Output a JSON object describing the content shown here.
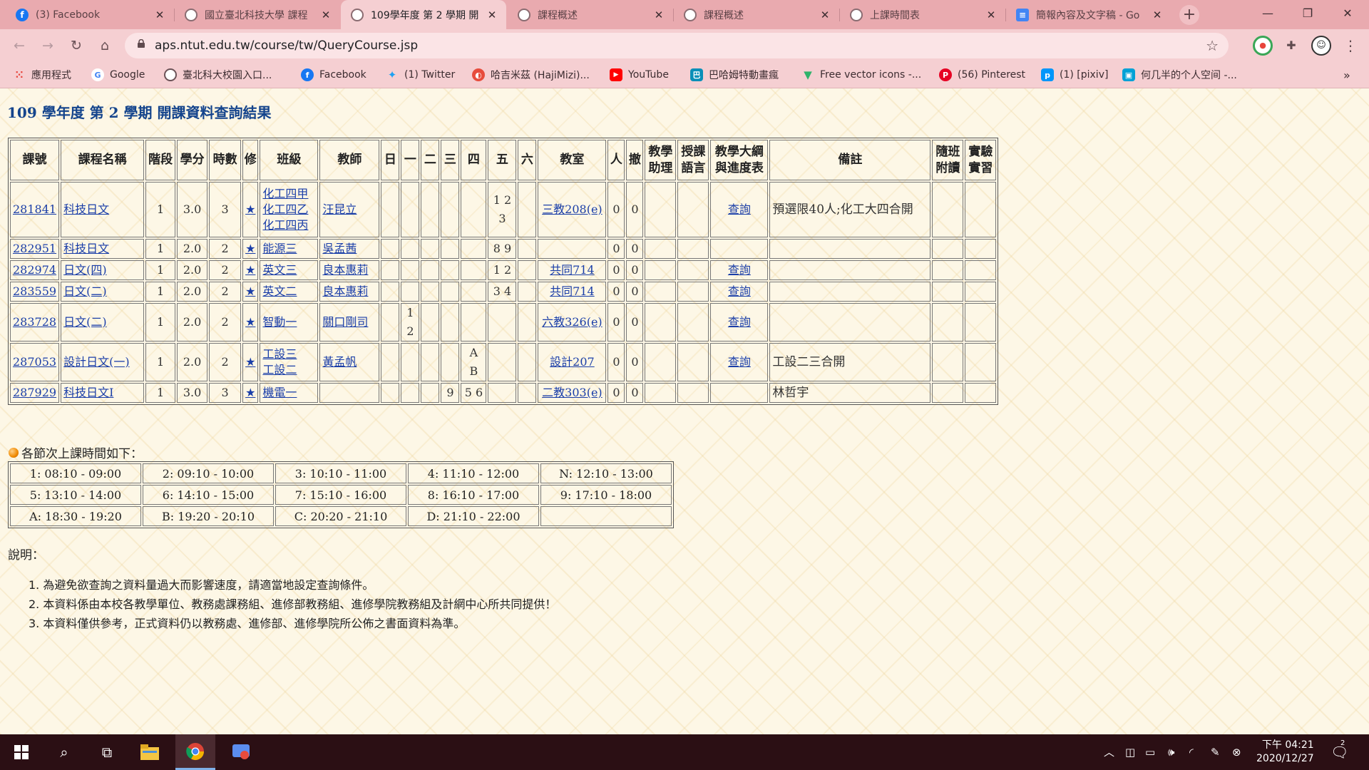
{
  "browser": {
    "tabs": [
      {
        "label": "(3) Facebook",
        "icon": "facebook-icon",
        "active": false
      },
      {
        "label": "國立臺北科技大學 課程",
        "icon": "globe-icon",
        "active": false
      },
      {
        "label": "109學年度 第 2 學期 開",
        "icon": "globe-icon",
        "active": true
      },
      {
        "label": "課程概述",
        "icon": "globe-icon",
        "active": false
      },
      {
        "label": "課程概述",
        "icon": "globe-icon",
        "active": false
      },
      {
        "label": "上課時間表",
        "icon": "globe-icon",
        "active": false
      },
      {
        "label": "簡報內容及文字稿 - Go",
        "icon": "google-docs-icon",
        "active": false
      }
    ],
    "url": "aps.ntut.edu.tw/course/tw/QueryCourse.jsp",
    "bookmarks": [
      {
        "label": "應用程式",
        "icon": "apps-grid-icon",
        "color": "#e8453c"
      },
      {
        "label": "Google",
        "icon": "google-icon",
        "color": "#4285f4"
      },
      {
        "label": "臺北科大校園入口...",
        "icon": "globe-icon",
        "color": "#6b5257"
      },
      {
        "label": "Facebook",
        "icon": "facebook-icon",
        "color": "#1877f2"
      },
      {
        "label": "(1) Twitter",
        "icon": "twitter-icon",
        "color": "#1da1f2"
      },
      {
        "label": "哈吉米茲 (HajiMizi)...",
        "icon": "hajimizi-icon",
        "color": "#e74c3c"
      },
      {
        "label": "YouTube",
        "icon": "youtube-icon",
        "color": "#ff0000"
      },
      {
        "label": "巴哈姆特動畫瘋",
        "icon": "bahamut-icon",
        "color": "#0a8fb8"
      },
      {
        "label": "Free vector icons -...",
        "icon": "freepik-icon",
        "color": "#2fb36b"
      },
      {
        "label": "(56) Pinterest",
        "icon": "pinterest-icon",
        "color": "#e60023"
      },
      {
        "label": "(1) [pixiv]",
        "icon": "pixiv-icon",
        "color": "#0096fa"
      },
      {
        "label": "何几半的个人空间 -...",
        "icon": "bilibili-icon",
        "color": "#00a1d6"
      }
    ],
    "bookmarks_overflow": "»"
  },
  "page": {
    "heading": "109 學年度 第 2 學期 開課資料查詢結果",
    "columns": [
      "課號",
      "課程名稱",
      "階段",
      "學分",
      "時數",
      "修",
      "班級",
      "教師",
      "日",
      "一",
      "二",
      "三",
      "四",
      "五",
      "六",
      "教室",
      "人",
      "撤",
      "教學助理",
      "授課語言",
      "教學大綱與進度表",
      "備註",
      "隨班附讀",
      "實驗實習"
    ],
    "rows": [
      {
        "id": "281841",
        "name": "科技日文",
        "stage": "1",
        "credit": "3.0",
        "hours": "3",
        "type": "★",
        "classes": [
          "化工四甲",
          "化工四乙",
          "化工四丙"
        ],
        "teacher": "汪昆立",
        "sun": "",
        "mon": "",
        "tue": "",
        "wed": "",
        "thu": "",
        "fri": "1 2 3",
        "sat": "",
        "room": "三教208(e)",
        "people": "0",
        "withdraw": "0",
        "ta": "",
        "lang": "",
        "syllabus": "查詢",
        "memo": "預選限40人;化工大四合開",
        "audit": "",
        "lab": ""
      },
      {
        "id": "282951",
        "name": "科技日文",
        "stage": "1",
        "credit": "2.0",
        "hours": "2",
        "type": "★",
        "classes": [
          "能源三"
        ],
        "teacher": "吳孟茜",
        "sun": "",
        "mon": "",
        "tue": "",
        "wed": "",
        "thu": "",
        "fri": "8 9",
        "sat": "",
        "room": "",
        "people": "0",
        "withdraw": "0",
        "ta": "",
        "lang": "",
        "syllabus": "",
        "memo": "",
        "audit": "",
        "lab": ""
      },
      {
        "id": "282974",
        "name": "日文(四)",
        "stage": "1",
        "credit": "2.0",
        "hours": "2",
        "type": "★",
        "classes": [
          "英文三"
        ],
        "teacher": "良本惠莉",
        "sun": "",
        "mon": "",
        "tue": "",
        "wed": "",
        "thu": "",
        "fri": "1 2",
        "sat": "",
        "room": "共同714",
        "people": "0",
        "withdraw": "0",
        "ta": "",
        "lang": "",
        "syllabus": "查詢",
        "memo": "",
        "audit": "",
        "lab": ""
      },
      {
        "id": "283559",
        "name": "日文(二)",
        "stage": "1",
        "credit": "2.0",
        "hours": "2",
        "type": "★",
        "classes": [
          "英文二"
        ],
        "teacher": "良本惠莉",
        "sun": "",
        "mon": "",
        "tue": "",
        "wed": "",
        "thu": "",
        "fri": "3 4",
        "sat": "",
        "room": "共同714",
        "people": "0",
        "withdraw": "0",
        "ta": "",
        "lang": "",
        "syllabus": "查詢",
        "memo": "",
        "audit": "",
        "lab": ""
      },
      {
        "id": "283728",
        "name": "日文(二)",
        "stage": "1",
        "credit": "2.0",
        "hours": "2",
        "type": "★",
        "classes": [
          "智動一"
        ],
        "teacher": "關口剛司",
        "sun": "",
        "mon": "1 2",
        "tue": "",
        "wed": "",
        "thu": "",
        "fri": "",
        "sat": "",
        "room": "六教326(e)",
        "people": "0",
        "withdraw": "0",
        "ta": "",
        "lang": "",
        "syllabus": "查詢",
        "memo": "",
        "audit": "",
        "lab": ""
      },
      {
        "id": "287053",
        "name": "設計日文(一)",
        "stage": "1",
        "credit": "2.0",
        "hours": "2",
        "type": "★",
        "classes": [
          "工設三",
          "工設二"
        ],
        "teacher": "黃孟帆",
        "sun": "",
        "mon": "",
        "tue": "",
        "wed": "",
        "thu": "A B",
        "fri": "",
        "sat": "",
        "room": "設計207",
        "people": "0",
        "withdraw": "0",
        "ta": "",
        "lang": "",
        "syllabus": "查詢",
        "memo": "工設二三合開",
        "audit": "",
        "lab": ""
      },
      {
        "id": "287929",
        "name": "科技日文I",
        "stage": "1",
        "credit": "3.0",
        "hours": "3",
        "type": "★",
        "classes": [
          "機電一"
        ],
        "teacher": "",
        "sun": "",
        "mon": "",
        "tue": "",
        "wed": "9",
        "thu": "5 6",
        "fri": "",
        "sat": "",
        "room": "二教303(e)",
        "people": "0",
        "withdraw": "0",
        "ta": "",
        "lang": "",
        "syllabus": "",
        "memo": "林哲宇",
        "audit": "",
        "lab": ""
      }
    ],
    "time_heading": "各節次上課時間如下：",
    "time_slots": [
      [
        "1: 08:10 - 09:00",
        "2: 09:10 - 10:00",
        "3: 10:10 - 11:00",
        "4: 11:10 - 12:00",
        "N: 12:10 - 13:00"
      ],
      [
        "5: 13:10 - 14:00",
        "6: 14:10 - 15:00",
        "7: 15:10 - 16:00",
        "8: 16:10 - 17:00",
        "9: 17:10 - 18:00"
      ],
      [
        "A: 18:30 - 19:20",
        "B: 19:20 - 20:10",
        "C: 20:20 - 21:10",
        "D: 21:10 - 22:00",
        ""
      ]
    ],
    "notes_title": "說明：",
    "notes": [
      "1. 為避免欲查詢之資料量過大而影響速度，請適當地設定查詢條件。",
      "2. 本資料係由本校各教學單位、教務處課務組、進修部教務組、進修學院教務組及計網中心所共同提供！",
      "3. 本資料僅供參考，正式資料仍以教務處、進修部、進修學院所公佈之書面資料為準。"
    ]
  },
  "taskbar": {
    "time": "下午 04:21",
    "date": "2020/12/27",
    "notification_count": "2"
  },
  "colors": {
    "tab_bg": "#e9aaaf",
    "toolbar_bg": "#f5cfd2",
    "page_bg": "#fdf7e6",
    "link": "#1a3ea8",
    "heading": "#14448c",
    "taskbar_bg": "#2b0f14"
  }
}
